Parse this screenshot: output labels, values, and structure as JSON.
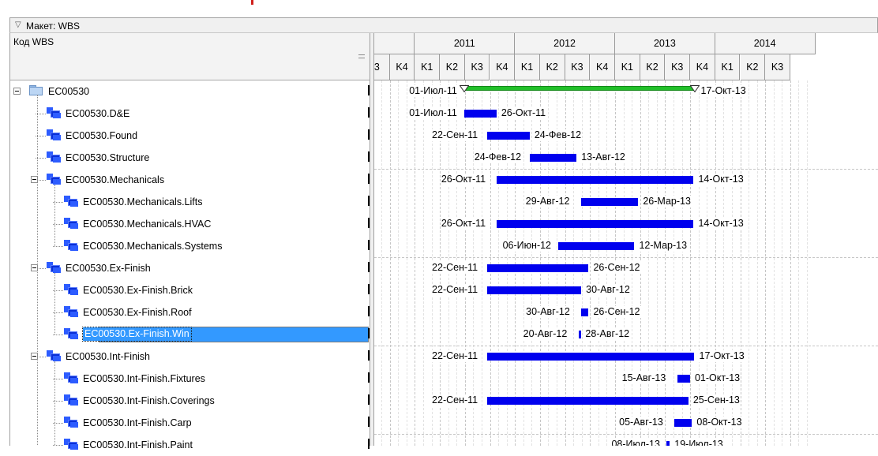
{
  "layout_label": "Макет: WBS",
  "column_header": "Код WBS",
  "timescale": {
    "years": [
      {
        "label": "2011"
      },
      {
        "label": "2012"
      },
      {
        "label": "2013"
      },
      {
        "label": "2014"
      }
    ],
    "quarters": [
      "3",
      "K4",
      "K1",
      "K2",
      "K3",
      "K4",
      "K1",
      "K2",
      "K3",
      "K4",
      "K1",
      "K2",
      "K3",
      "K4",
      "K1",
      "K2",
      "K3"
    ]
  },
  "rows": [
    {
      "label": "EC00530",
      "start": "01-Июл-11",
      "end": "17-Окт-13",
      "style": "summary"
    },
    {
      "label": "EC00530.D&E",
      "start": "01-Июл-11",
      "end": "26-Окт-11"
    },
    {
      "label": "EC00530.Found",
      "start": "22-Сен-11",
      "end": "24-Фев-12"
    },
    {
      "label": "EC00530.Structure",
      "start": "24-Фев-12",
      "end": "13-Авг-12"
    },
    {
      "label": "EC00530.Mechanicals",
      "start": "26-Окт-11",
      "end": "14-Окт-13"
    },
    {
      "label": "EC00530.Mechanicals.Lifts",
      "start": "29-Авг-12",
      "end": "26-Мар-13"
    },
    {
      "label": "EC00530.Mechanicals.HVAC",
      "start": "26-Окт-11",
      "end": "14-Окт-13"
    },
    {
      "label": "EC00530.Mechanicals.Systems",
      "start": "06-Июн-12",
      "end": "12-Мар-13"
    },
    {
      "label": "EC00530.Ex-Finish",
      "start": "22-Сен-11",
      "end": "26-Сен-12"
    },
    {
      "label": "EC00530.Ex-Finish.Brick",
      "start": "22-Сен-11",
      "end": "30-Авг-12"
    },
    {
      "label": "EC00530.Ex-Finish.Roof",
      "start": "30-Авг-12",
      "end": "26-Сен-12"
    },
    {
      "label": "EC00530.Ex-Finish.Win",
      "start": "20-Авг-12",
      "end": "28-Авг-12",
      "selected": true
    },
    {
      "label": "EC00530.Int-Finish",
      "start": "22-Сен-11",
      "end": "17-Окт-13"
    },
    {
      "label": "EC00530.Int-Finish.Fixtures",
      "start": "15-Авг-13",
      "end": "01-Окт-13"
    },
    {
      "label": "EC00530.Int-Finish.Coverings",
      "start": "22-Сен-11",
      "end": "25-Сен-13"
    },
    {
      "label": "EC00530.Int-Finish.Carp",
      "start": "05-Авг-13",
      "end": "08-Окт-13"
    },
    {
      "label": "EC00530.Int-Finish.Paint",
      "start": "08-Июл-13",
      "end": "19-Июл-13"
    }
  ],
  "colors": {
    "bar": "#0000ee",
    "summary_bar": "#22c02a",
    "selection": "#3399ff"
  },
  "icons": {
    "root": "folder-icon",
    "node": "wbs-icon",
    "expander": "collapse-icon"
  }
}
